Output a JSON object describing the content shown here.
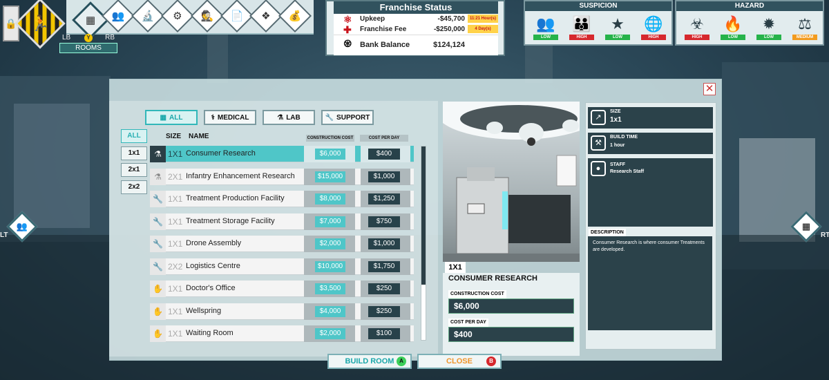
{
  "top_icons": {
    "rooms_label": "ROOMS",
    "lb": "LB",
    "rb": "RB",
    "y": "Y"
  },
  "franchise": {
    "title": "Franchise Status",
    "upkeep_label": "Upkeep",
    "upkeep_value": "-$45,700",
    "upkeep_tag": "11:21 Hour(s)",
    "fee_label": "Franchise Fee",
    "fee_value": "-$250,000",
    "fee_tag": "4 Day(s)",
    "balance_label": "Bank Balance",
    "balance_value": "$124,124"
  },
  "suspicion": {
    "title": "SUSPICION",
    "items": [
      {
        "icon": "crowd-icon",
        "level": "LOW",
        "color": "#26b34a"
      },
      {
        "icon": "group-icon",
        "level": "HIGH",
        "color": "#d6282d"
      },
      {
        "icon": "police-badge-icon",
        "level": "LOW",
        "color": "#26b34a"
      },
      {
        "icon": "media-icon",
        "level": "HIGH",
        "color": "#d6282d"
      }
    ]
  },
  "hazard": {
    "title": "HAZARD",
    "items": [
      {
        "icon": "biohazard-icon",
        "level": "HIGH",
        "color": "#d6282d"
      },
      {
        "icon": "fire-icon",
        "level": "LOW",
        "color": "#26b34a"
      },
      {
        "icon": "explosion-icon",
        "level": "LOW",
        "color": "#26b34a"
      },
      {
        "icon": "legal-scales-icon",
        "level": "MEDIUM",
        "color": "#f29b1e"
      }
    ]
  },
  "side": {
    "left": "LT",
    "right": "RT"
  },
  "tabs": [
    "ALL",
    "MEDICAL",
    "LAB",
    "SUPPORT"
  ],
  "size_filters": [
    "ALL",
    "1x1",
    "2x1",
    "2x2"
  ],
  "list_headers": {
    "size": "SIZE",
    "name": "NAME",
    "construction": "CONSTRUCTION COST",
    "per_day": "COST PER DAY"
  },
  "rooms": [
    {
      "size": "1X1",
      "name": "Consumer Research",
      "cost": "$6,000",
      "per_day": "$400"
    },
    {
      "size": "2X1",
      "name": "Infantry Enhancement Research",
      "cost": "$15,000",
      "per_day": "$1,000"
    },
    {
      "size": "1X1",
      "name": "Treatment Production Facility",
      "cost": "$8,000",
      "per_day": "$1,250"
    },
    {
      "size": "1X1",
      "name": "Treatment Storage Facility",
      "cost": "$7,000",
      "per_day": "$750"
    },
    {
      "size": "1X1",
      "name": "Drone Assembly",
      "cost": "$2,000",
      "per_day": "$1,000"
    },
    {
      "size": "2X2",
      "name": "Logistics Centre",
      "cost": "$10,000",
      "per_day": "$1,750"
    },
    {
      "size": "1X1",
      "name": "Doctor's Office",
      "cost": "$3,500",
      "per_day": "$250"
    },
    {
      "size": "1X1",
      "name": "Wellspring",
      "cost": "$4,000",
      "per_day": "$250"
    },
    {
      "size": "1X1",
      "name": "Waiting Room",
      "cost": "$2,000",
      "per_day": "$100"
    }
  ],
  "selected": {
    "size": "1X1",
    "name": "CONSUMER RESEARCH",
    "construction_label": "CONSTRUCTION COST",
    "construction_value": "$6,000",
    "per_day_label": "COST PER DAY",
    "per_day_value": "$400"
  },
  "details": {
    "size_label": "SIZE",
    "size_value": "1x1",
    "time_label": "BUILD TIME",
    "time_value": "1 hour",
    "staff_label": "STAFF",
    "staff_value": "Research Staff",
    "desc_label": "DESCRIPTION",
    "desc_value": "Consumer Research is where consumer Treatments are developed."
  },
  "buttons": {
    "build": "BUILD ROOM",
    "build_key": "A",
    "close": "CLOSE",
    "close_key": "B"
  }
}
